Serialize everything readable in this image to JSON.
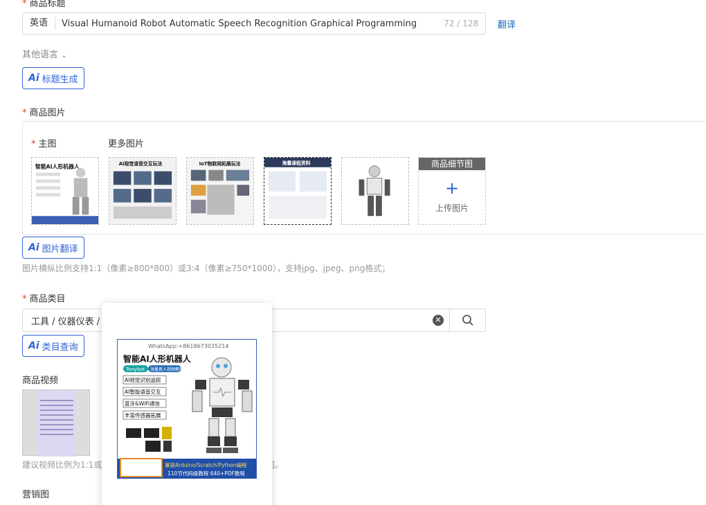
{
  "title_section": {
    "label": "商品标题",
    "lang": "英语",
    "value": "Visual Humanoid Robot Automatic Speech Recognition Graphical Programming",
    "count": "72 / 128",
    "translate": "翻译",
    "other_lang": "其他语言",
    "ai_btn": "标题生成"
  },
  "images_section": {
    "label": "商品图片",
    "main_label": "主图",
    "more_label": "更多图片",
    "thumbs": [
      {
        "caption": "智能AI人形机器人"
      },
      {
        "caption": "AI视觉语音交互玩法"
      },
      {
        "caption": "IoT物联网拓展玩法"
      },
      {
        "caption": "海量课程资料"
      },
      {
        "caption": ""
      }
    ],
    "detail_header": "商品细节图",
    "upload_label": "上传图片",
    "ai_btn": "图片翻译",
    "hint": "图片横纵比例支持1:1（像素≥800*800）或3:4（像素≥750*1000），支持jpg、jpeg、png格式；"
  },
  "category_section": {
    "label": "商品类目",
    "value": "工具 / 仪器仪表 /",
    "ai_btn": "类目查询"
  },
  "video_section": {
    "label": "商品视频",
    "hint_start": "建议视频比例为1:1或",
    "hint_end": "]。"
  },
  "marketing_label": "营销图",
  "popup": {
    "whatsapp": "WhatsApp:+8618673035214",
    "heading": "智能AI人形机器人",
    "brand": "Tonybot",
    "brand_tag": "海量真人视频教程",
    "features": [
      "AI视觉识别追踪",
      "AI智能语音交互",
      "蓝牙&WiFi通信",
      "丰富传感器拓展"
    ],
    "footer1": "兼容Arduino/Scratch/Python编程",
    "footer2": "110节代码级教程 640+PDF教程"
  },
  "colors": {
    "accent": "#2e63d6",
    "required": "#e5372f",
    "link": "#1769c5"
  }
}
